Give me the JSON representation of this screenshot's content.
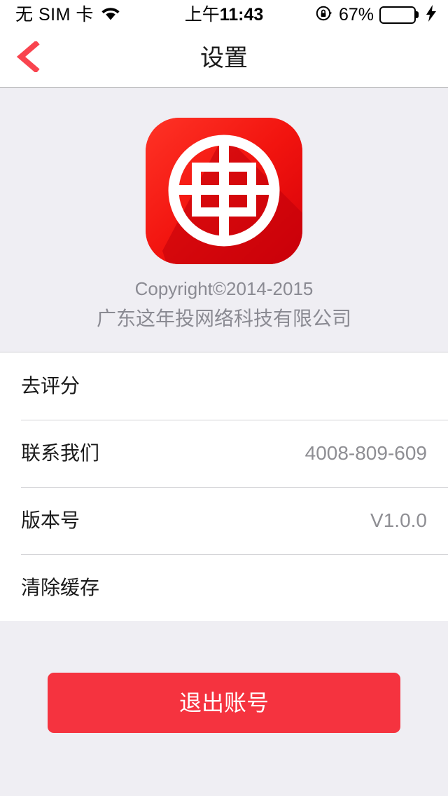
{
  "status_bar": {
    "carrier": "无 SIM 卡",
    "wifi_icon": "wifi-icon",
    "time": "11:43",
    "time_prefix": "上午",
    "rotation_lock_icon": "rotation-lock-icon",
    "battery_percent_label": "67%",
    "battery_level": 67,
    "charging_icon": "lightning-bolt-icon",
    "battery_color": "#4CD964"
  },
  "nav": {
    "back_icon": "chevron-left-icon",
    "back_color": "#F9444F",
    "title": "设置"
  },
  "header": {
    "app_icon_name": "app-logo-icon",
    "app_icon_color": "#F01313",
    "copyright": "Copyright©2014-2015",
    "company": "广东这年投网络科技有限公司"
  },
  "list": {
    "rows": [
      {
        "label": "去评分",
        "value": ""
      },
      {
        "label": "联系我们",
        "value": "4008-809-609"
      },
      {
        "label": "版本号",
        "value": "V1.0.0"
      },
      {
        "label": "清除缓存",
        "value": ""
      }
    ]
  },
  "footer": {
    "logout_label": "退出账号",
    "logout_color": "#F5333F"
  }
}
